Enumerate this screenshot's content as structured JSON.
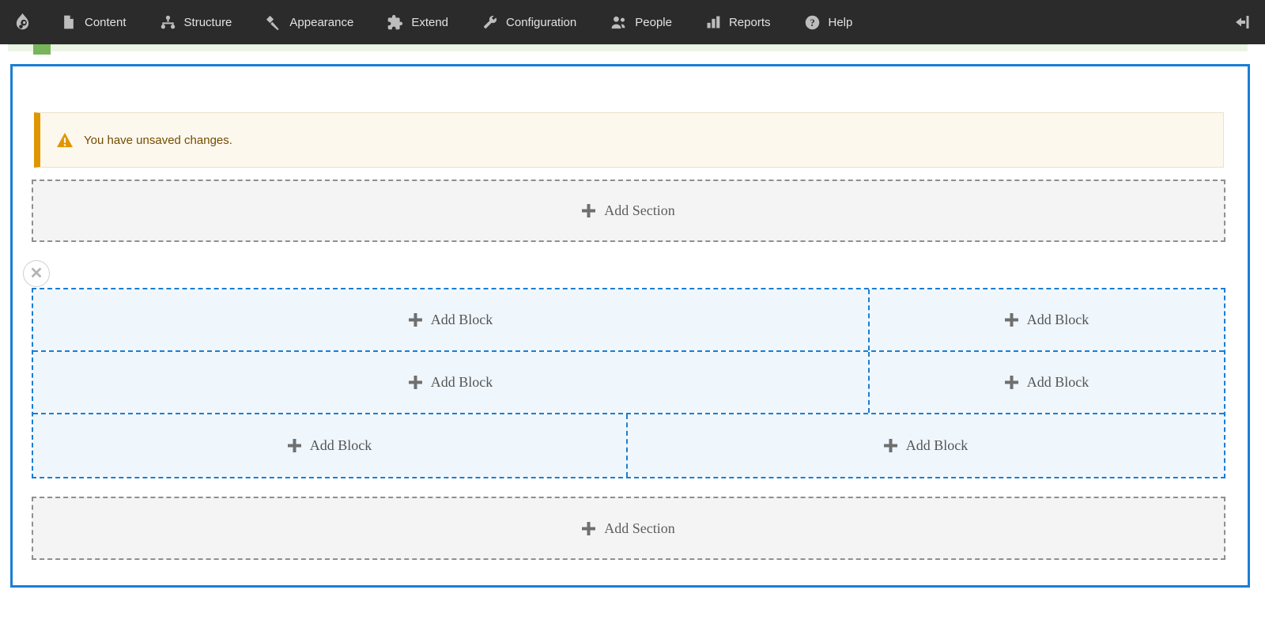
{
  "toolbar": {
    "items": [
      {
        "label": "Content",
        "icon": "document-icon"
      },
      {
        "label": "Structure",
        "icon": "sitemap-icon"
      },
      {
        "label": "Appearance",
        "icon": "paintbrush-icon"
      },
      {
        "label": "Extend",
        "icon": "puzzle-icon"
      },
      {
        "label": "Configuration",
        "icon": "wrench-icon"
      },
      {
        "label": "People",
        "icon": "people-icon"
      },
      {
        "label": "Reports",
        "icon": "bar-chart-icon"
      },
      {
        "label": "Help",
        "icon": "question-icon"
      }
    ]
  },
  "messages": {
    "warning": {
      "text": "You have unsaved changes.",
      "icon": "warning-triangle-icon"
    }
  },
  "layout_builder": {
    "add_section_top": {
      "label": "Add Section"
    },
    "add_section_bottom": {
      "label": "Add Section"
    },
    "section": {
      "remove_glyph": "✕",
      "regions": [
        {
          "label": "Add Block"
        },
        {
          "label": "Add Block"
        },
        {
          "label": "Add Block"
        },
        {
          "label": "Add Block"
        },
        {
          "label": "Add Block"
        },
        {
          "label": "Add Block"
        }
      ]
    }
  },
  "colors": {
    "toolbar_bg": "#2b2b2b",
    "accent_blue": "#1a7ed4",
    "region_bg": "#eff6fc",
    "warning_accent": "#e09600",
    "warning_bg": "#fdf8ee",
    "warning_text": "#734c00",
    "success_green": "#77b55a",
    "dashed_gray": "#8f8f8f"
  }
}
